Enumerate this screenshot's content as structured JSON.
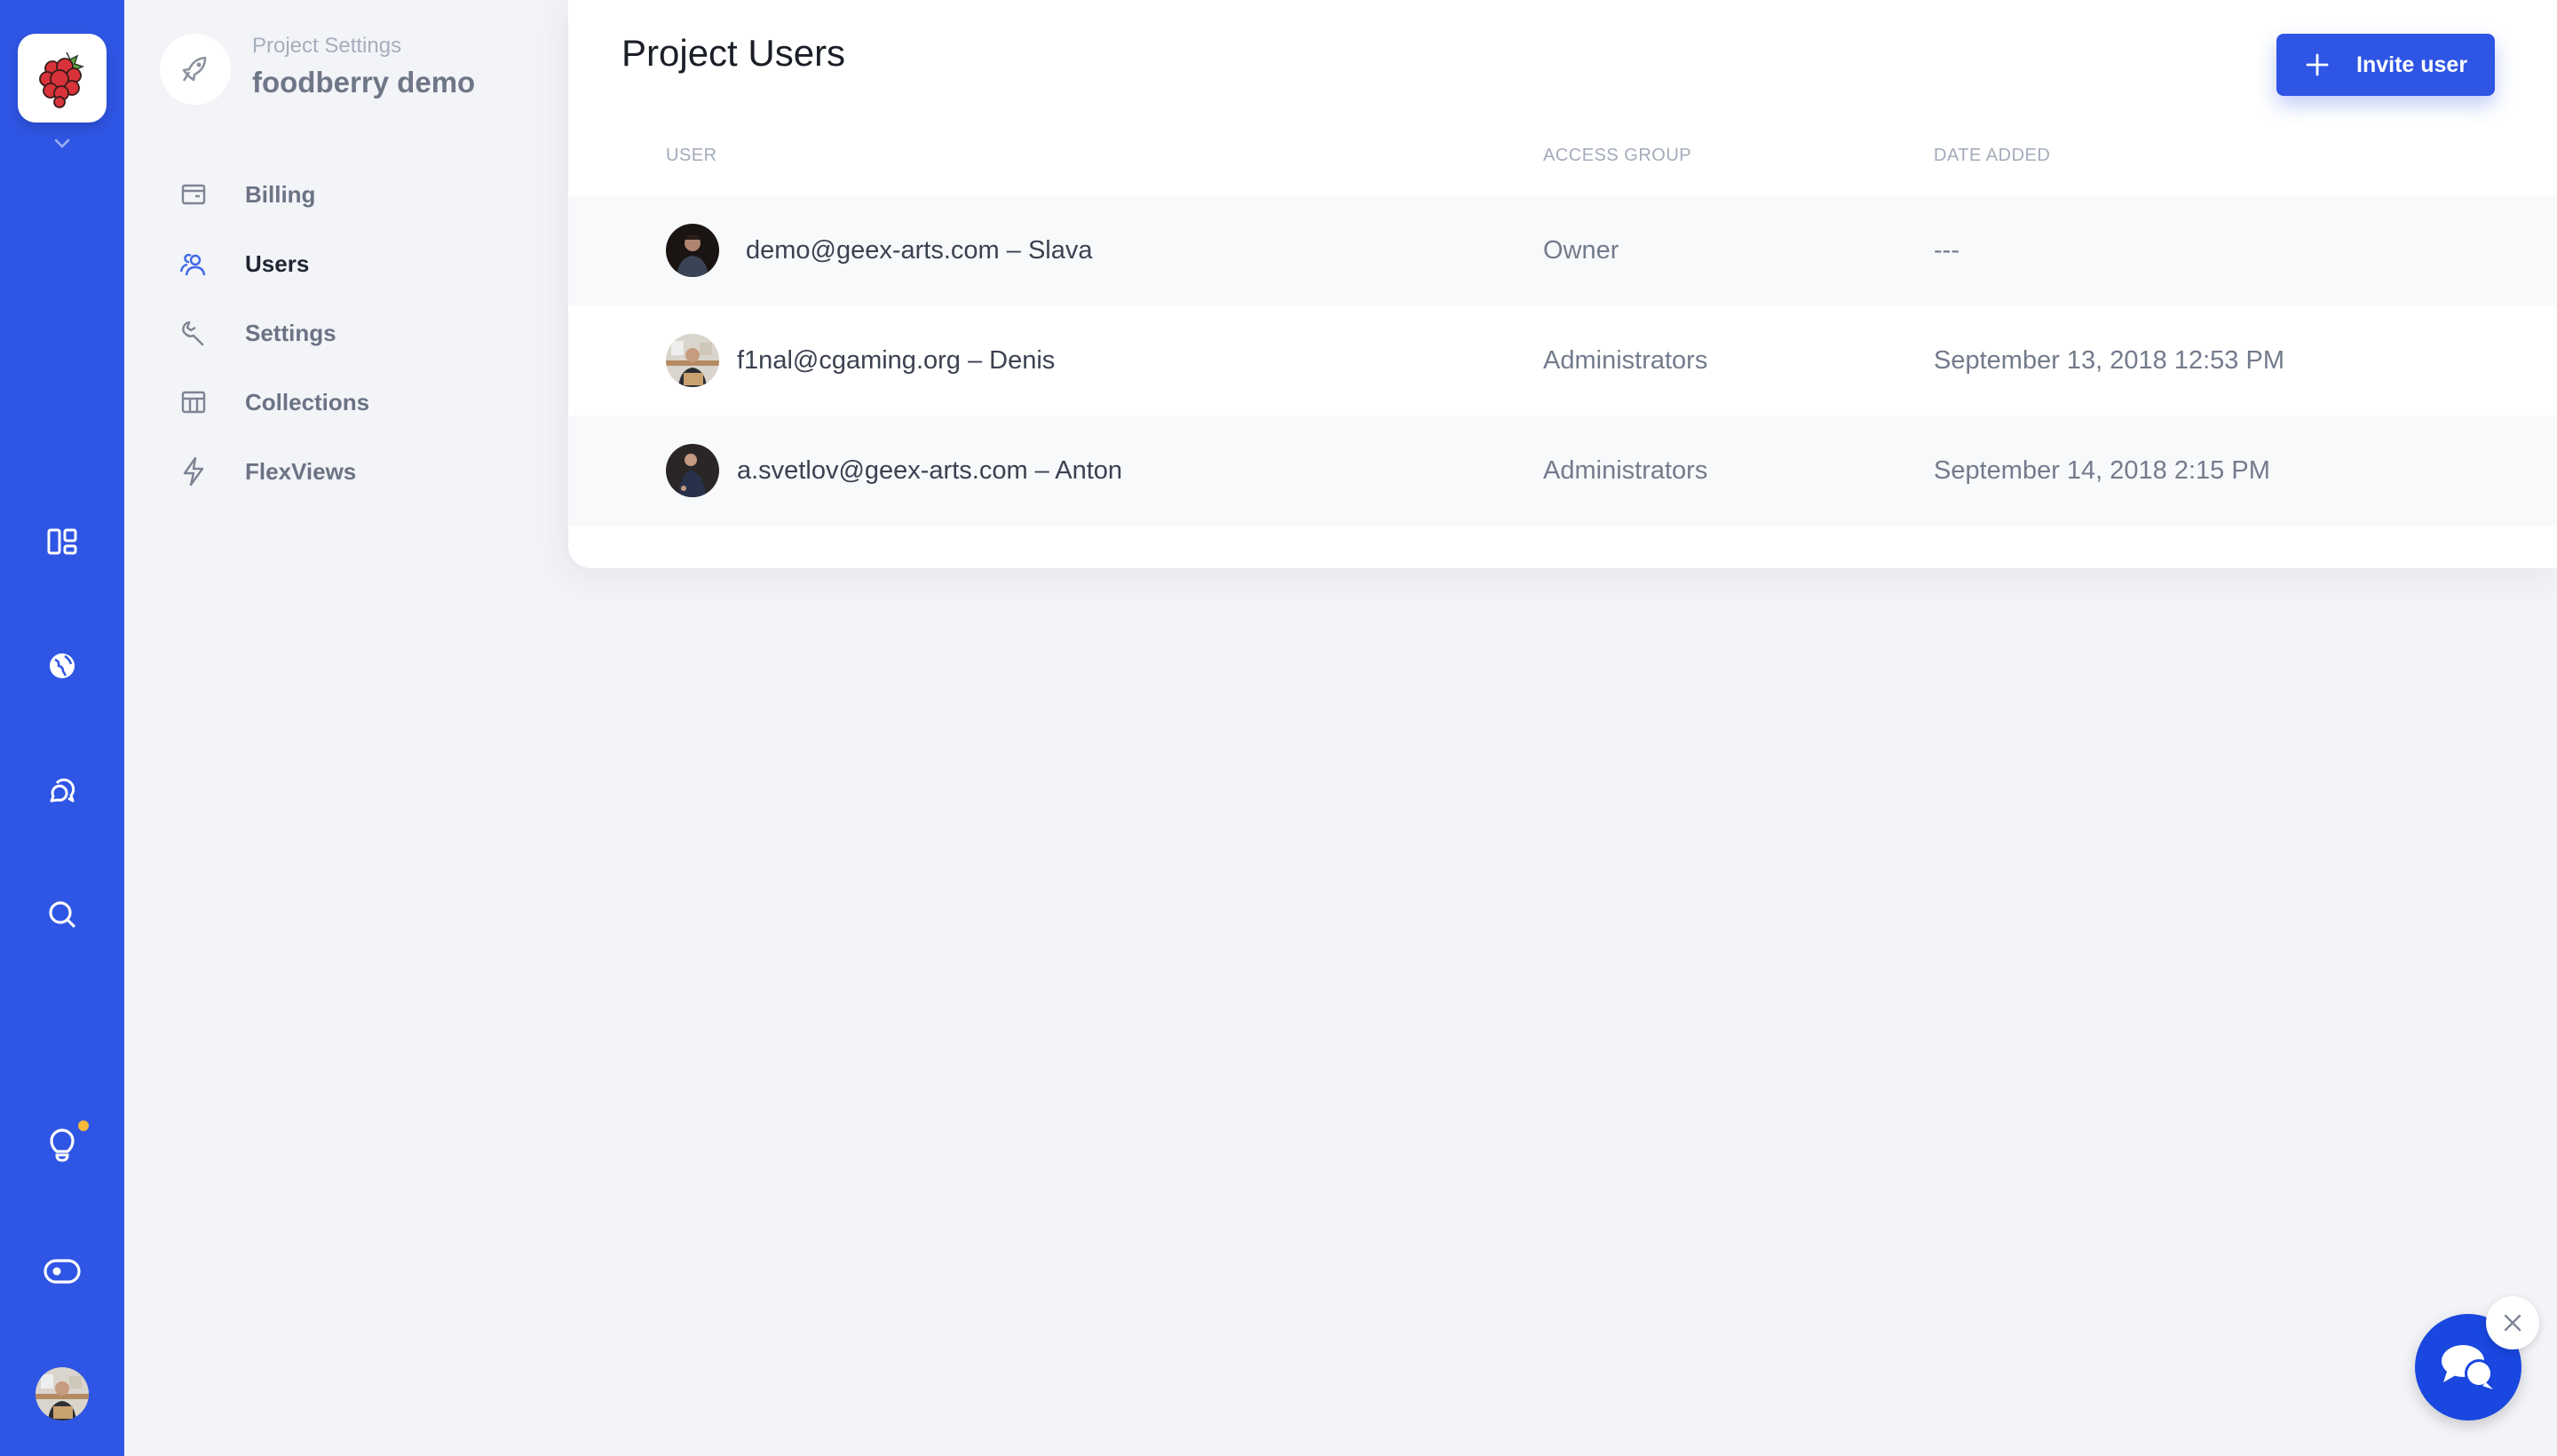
{
  "rail": {
    "app_logo": "raspberry-logo",
    "icons": [
      {
        "name": "dashboard-icon"
      },
      {
        "name": "globe-icon"
      },
      {
        "name": "chat-bubbles-icon"
      },
      {
        "name": "search-icon"
      },
      {
        "name": "lightbulb-icon"
      },
      {
        "name": "toggle-icon"
      }
    ],
    "notification_dot_color": "#f6b93b",
    "accent_color": "#2f55e4"
  },
  "settings_panel": {
    "kicker": "Project Settings",
    "project_name": "foodberry demo",
    "nav": [
      {
        "label": "Billing",
        "icon": "billing-icon",
        "active": false
      },
      {
        "label": "Users",
        "icon": "users-icon",
        "active": true
      },
      {
        "label": "Settings",
        "icon": "wrench-icon",
        "active": false
      },
      {
        "label": "Collections",
        "icon": "table-icon",
        "active": false
      },
      {
        "label": "FlexViews",
        "icon": "lightning-icon",
        "active": false
      }
    ]
  },
  "main": {
    "title": "Project Users",
    "invite_button": "Invite user",
    "columns": {
      "user": "USER",
      "access": "ACCESS GROUP",
      "date": "DATE ADDED"
    },
    "rows": [
      {
        "user": "demo@geex-arts.com – Slava",
        "access": "Owner",
        "date": "---"
      },
      {
        "user": "f1nal@cgaming.org – Denis",
        "access": "Administrators",
        "date": "September 13, 2018 12:53 PM"
      },
      {
        "user": "a.svetlov@geex-arts.com – Anton",
        "access": "Administrators",
        "date": "September 14, 2018 2:15 PM"
      }
    ]
  },
  "chat_widget": {
    "launcher_icon": "chat-icon",
    "close_icon": "close-icon"
  }
}
